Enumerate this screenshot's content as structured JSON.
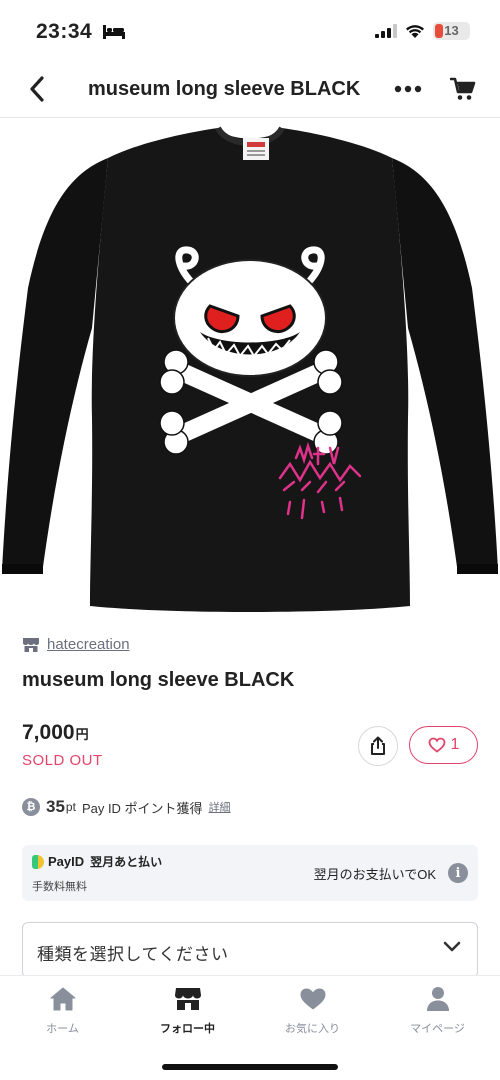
{
  "status_bar": {
    "time": "23:34",
    "battery": "13"
  },
  "navbar": {
    "title": "museum long sleeve BLACK"
  },
  "product": {
    "shop_name": "hatecreation",
    "title": "museum long sleeve BLACK",
    "price": "7,000",
    "price_unit": "円",
    "status": "SOLD OUT",
    "like_count": "1"
  },
  "points": {
    "value": "35",
    "unit": "pt",
    "text": "Pay ID ポイント獲得",
    "details_link": "詳細"
  },
  "payid": {
    "brand": "PayID",
    "service": "翌月あと払い",
    "fee": "手数料無料",
    "ok_text": "翌月のお支払いでOK"
  },
  "variant": {
    "placeholder": "種類を選択してください"
  },
  "tabbar": {
    "tabs": [
      {
        "label": "ホーム",
        "icon": "home-icon"
      },
      {
        "label": "フォロー中",
        "icon": "store-icon"
      },
      {
        "label": "お気に入り",
        "icon": "heart-icon"
      },
      {
        "label": "マイページ",
        "icon": "person-icon"
      }
    ]
  },
  "colors": {
    "accent_pink": "#e2456b",
    "tab_inactive": "#8a8f9c",
    "print_pink": "#e0328a",
    "eye_red": "#e01f1f"
  }
}
